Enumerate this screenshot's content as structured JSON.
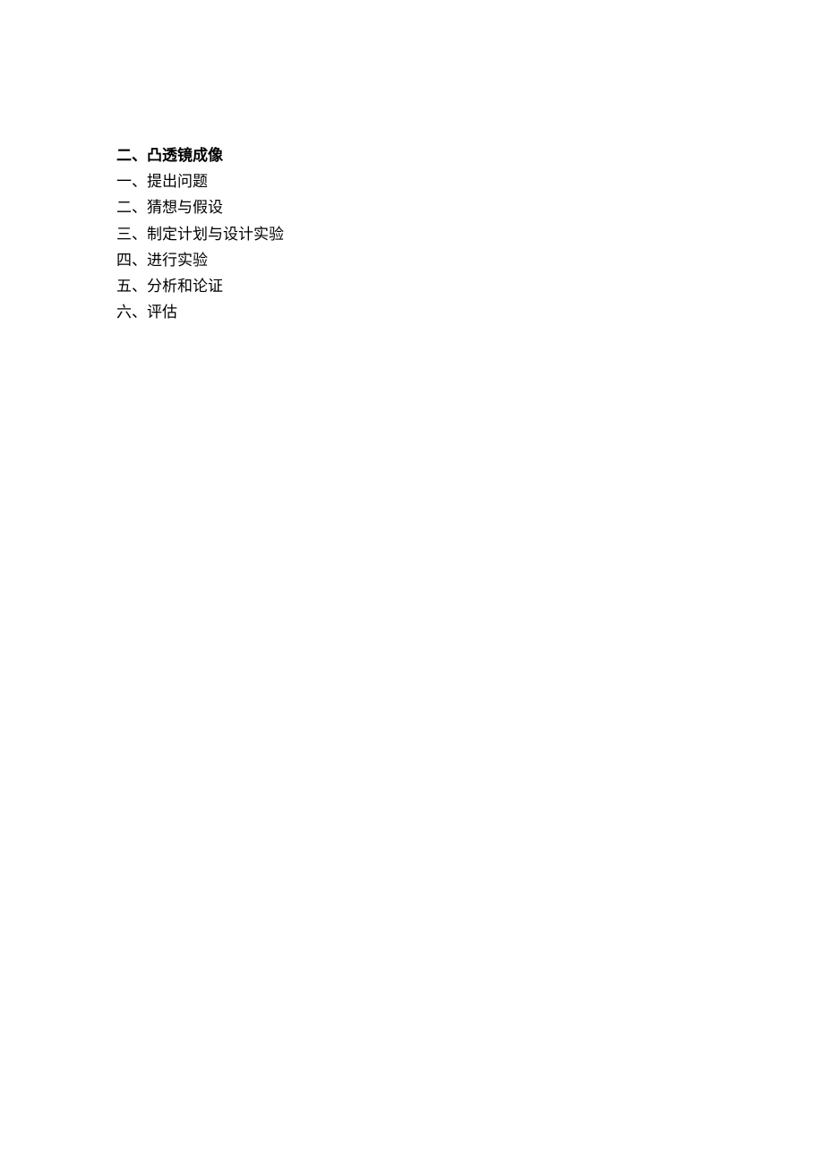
{
  "title": "二、凸透镜成像",
  "items": [
    "一、提出问题",
    "二、猜想与假设",
    "三、制定计划与设计实验",
    "四、进行实验",
    "五、分析和论证",
    "六、评估"
  ]
}
